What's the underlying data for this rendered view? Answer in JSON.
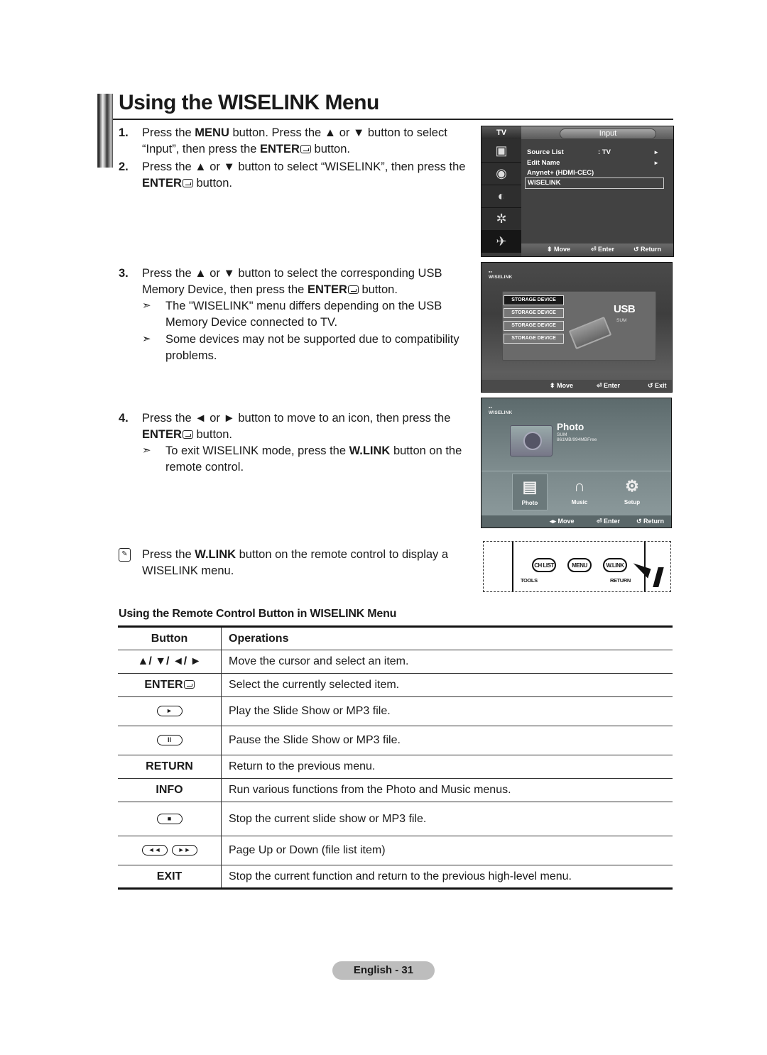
{
  "page": {
    "title": "Using the WISELINK Menu",
    "footer": "English - 31"
  },
  "steps": [
    {
      "num": "1.",
      "segments": [
        {
          "t": "Press the ",
          "b": false
        },
        {
          "t": "MENU",
          "b": true
        },
        {
          "t": " button. Press the ▲ or ▼ button to select “Input”, then press the ",
          "b": false
        },
        {
          "t": "ENTER",
          "b": true,
          "enter": true
        },
        {
          "t": " button.",
          "b": false
        }
      ]
    },
    {
      "num": "2.",
      "segments": [
        {
          "t": "Press the ▲ or ▼ button to select “WISELINK”, then press the ",
          "b": false
        },
        {
          "t": "ENTER",
          "b": true,
          "enter": true
        },
        {
          "t": " button.",
          "b": false
        }
      ]
    },
    {
      "num": "3.",
      "segments": [
        {
          "t": "Press the ▲ or ▼ button to select the corresponding USB Memory Device, then press the ",
          "b": false
        },
        {
          "t": "ENTER",
          "b": true,
          "enter": true
        },
        {
          "t": " button.",
          "b": false
        }
      ],
      "notes": [
        "The \"WISELINK\" menu differs depending on the USB Memory Device connected to TV.",
        "Some devices may not be supported due to compatibility problems."
      ]
    },
    {
      "num": "4.",
      "segments": [
        {
          "t": "Press the ◄ or ► button to move to an icon, then press the ",
          "b": false
        },
        {
          "t": "ENTER",
          "b": true,
          "enter": true
        },
        {
          "t": " button.",
          "b": false
        }
      ],
      "notes_rich": [
        [
          {
            "t": "To exit WISELINK mode, press the ",
            "b": false
          },
          {
            "t": "W.LINK",
            "b": true
          },
          {
            "t": " button on the remote control.",
            "b": false
          }
        ]
      ]
    }
  ],
  "memo": [
    {
      "t": "Press the ",
      "b": false
    },
    {
      "t": "W.LINK",
      "b": true
    },
    {
      "t": " button on the remote control to display a WISELINK menu.",
      "b": false
    }
  ],
  "screen_input": {
    "tv_label": "TV",
    "header": "Input",
    "side_icons": [
      "picture-icon",
      "sound-icon",
      "channel-icon",
      "setup-icon",
      "input-icon"
    ],
    "rows": [
      {
        "label": "Source List",
        "value": ": TV",
        "arrow": "►"
      },
      {
        "label": "Edit Name",
        "value": "",
        "arrow": "►"
      },
      {
        "label": "Anynet+ (HDMI-CEC)",
        "value": "",
        "arrow": ""
      },
      {
        "label": "WISELINK",
        "value": "",
        "arrow": "",
        "selected": true
      }
    ],
    "footer": {
      "move": "Move",
      "enter": "Enter",
      "return": "Return"
    }
  },
  "screen_device": {
    "logo": "WISELINK",
    "devices": [
      "STORAGE DEVICE",
      "STORAGE DEVICE",
      "STORAGE DEVICE",
      "STORAGE DEVICE"
    ],
    "selected_index": 0,
    "usb_label": "USB",
    "usb_sub": "SUM",
    "footer": {
      "move": "Move",
      "enter": "Enter",
      "exit": "Exit"
    }
  },
  "screen_photo": {
    "logo": "WISELINK",
    "title": "Photo",
    "sub1": "SUM",
    "sub2": "861MB/994MBFree",
    "tiles": [
      "Photo",
      "Music",
      "Setup"
    ],
    "selected_tile": "Photo",
    "footer": {
      "move": "Move",
      "enter": "Enter",
      "return": "Return"
    }
  },
  "remote": {
    "ch_list": "CH LIST",
    "menu": "MENU",
    "wlink": "W.LINK",
    "tools": "TOOLS",
    "return": "RETURN"
  },
  "table": {
    "title": "Using the Remote Control Button in WISELINK Menu",
    "headers": [
      "Button",
      "Operations"
    ],
    "rows": [
      {
        "button": "▲/ ▼/ ◄/ ►",
        "type": "text",
        "op": "Move the cursor and select an item."
      },
      {
        "button": "ENTER",
        "type": "enter",
        "op": "Select the currently selected item."
      },
      {
        "button": "►",
        "type": "pill",
        "op": "Play the Slide Show or MP3 file."
      },
      {
        "button": "II",
        "type": "pill",
        "op": "Pause the Slide Show or MP3 file."
      },
      {
        "button": "RETURN",
        "type": "text",
        "op": "Return to the previous menu."
      },
      {
        "button": "INFO",
        "type": "text",
        "op": "Run various functions from the Photo and Music menus."
      },
      {
        "button": "■",
        "type": "pill",
        "op": "Stop the current slide show or MP3 file."
      },
      {
        "button": "◄◄|►►",
        "type": "pill2",
        "op": "Page Up or Down (file list item)"
      },
      {
        "button": "EXIT",
        "type": "text",
        "op": "Stop the current function and return to the previous high-level menu."
      }
    ]
  }
}
